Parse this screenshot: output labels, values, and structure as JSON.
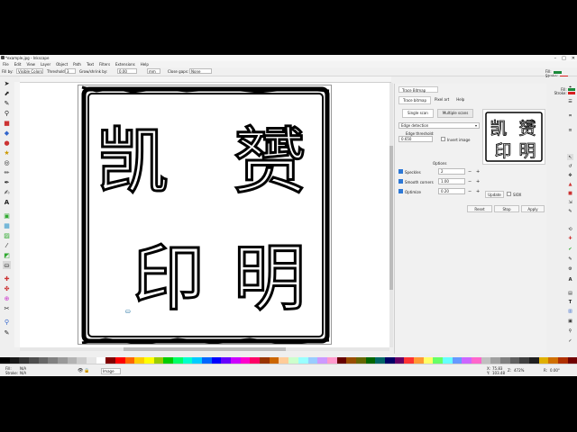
{
  "window": {
    "title": "*example.jpg - Inkscape",
    "minimize": "–",
    "maximize": "□",
    "close": "✕"
  },
  "menu": [
    "File",
    "Edit",
    "View",
    "Layer",
    "Object",
    "Path",
    "Text",
    "Filters",
    "Extensions",
    "Help"
  ],
  "tool_controls": {
    "fill_by_label": "Fill by:",
    "fill_by_value": "Visible Colors",
    "threshold_label": "Threshold:",
    "threshold_value": "3",
    "grow_label": "Grow/shrink by:",
    "grow_value": "0.00",
    "grow_unit": "mm",
    "close_gaps_label": "Close gaps:",
    "close_gaps_value": "None"
  },
  "style_indicator": {
    "fill_label": "Fill:",
    "stroke_label": "Stroke:",
    "fill_color": "#1a8a3a",
    "stroke_color": "#d62020"
  },
  "left_tools": [
    "selector-icon",
    "node-icon",
    "tweak-icon",
    "zoom-icon",
    "measure-icon",
    "rect-icon",
    "3dbox-icon",
    "ellipse-icon",
    "star-icon",
    "spiral-icon",
    "pencil-icon",
    "pen-icon",
    "calligraphy-icon",
    "text-icon",
    "spray-icon",
    "eraser-icon",
    "bucket-icon",
    "gradient-icon",
    "mesh-icon",
    "dropper-icon",
    "connector-icon"
  ],
  "seal": {
    "characters": [
      "凯",
      "赟",
      "印",
      "明"
    ]
  },
  "trace_panel": {
    "tab_title": "Trace Bitmap",
    "subtabs": [
      "Trace bitmap",
      "Pixel art",
      "Help"
    ],
    "modes": [
      "Single scan",
      "Multiple scans"
    ],
    "detection_mode": "Edge detection",
    "edge_threshold_label": "Edge threshold:",
    "edge_threshold_value": "0.650",
    "invert_label": "Invert image",
    "options_heading": "Options",
    "speckles_label": "Speckles",
    "speckles_value": "2",
    "smooth_label": "Smooth corners",
    "smooth_value": "1.00",
    "optimize_label": "Optimize",
    "optimize_value": "0.20",
    "update_label": "Update",
    "sioX_label": "SIOX",
    "reset_label": "Reset",
    "stop_label": "Stop",
    "apply_label": "Apply",
    "plus": "+",
    "minus": "−"
  },
  "right_style": {
    "fill_label": "Fill:",
    "stroke_label": "Stroke:"
  },
  "palette": [
    "#000000",
    "#1a1a1a",
    "#333333",
    "#4d4d4d",
    "#666666",
    "#808080",
    "#999999",
    "#b3b3b3",
    "#cccccc",
    "#e6e6e6",
    "#ffffff",
    "#800000",
    "#ff0000",
    "#ff6600",
    "#ffcc00",
    "#ffff00",
    "#99cc00",
    "#00cc00",
    "#00ff66",
    "#00ffcc",
    "#00ccff",
    "#0066ff",
    "#0000ff",
    "#6600ff",
    "#cc00ff",
    "#ff00cc",
    "#ff0066",
    "#993300",
    "#cc6600",
    "#ffcc99",
    "#ccffcc",
    "#99ffff",
    "#99ccff",
    "#cc99ff",
    "#ff99cc",
    "#660000",
    "#994d00",
    "#666600",
    "#006600",
    "#006666",
    "#000066",
    "#660066",
    "#ff3333",
    "#ff9933",
    "#ffff66",
    "#66ff66",
    "#66ffff",
    "#6699ff",
    "#cc66ff",
    "#ff66cc",
    "#c0c0c0",
    "#a0a0a0",
    "#7f7f7f",
    "#5f5f5f",
    "#3f3f3f",
    "#1f1f1f",
    "#e0b000",
    "#d07000",
    "#b03000",
    "#700000"
  ],
  "status": {
    "fill_label": "Fill:",
    "fill_value": "N/A",
    "stroke_label": "Stroke:",
    "stroke_value": "N/A",
    "opacity_value": "100",
    "layer_value": "Image",
    "x_label": "X:",
    "x_value": "75.83",
    "y_label": "Y:",
    "y_value": "103.48",
    "zoom_label": "Z:",
    "zoom_value": "472%",
    "rotate_label": "R:",
    "rotate_value": "0.00°"
  }
}
